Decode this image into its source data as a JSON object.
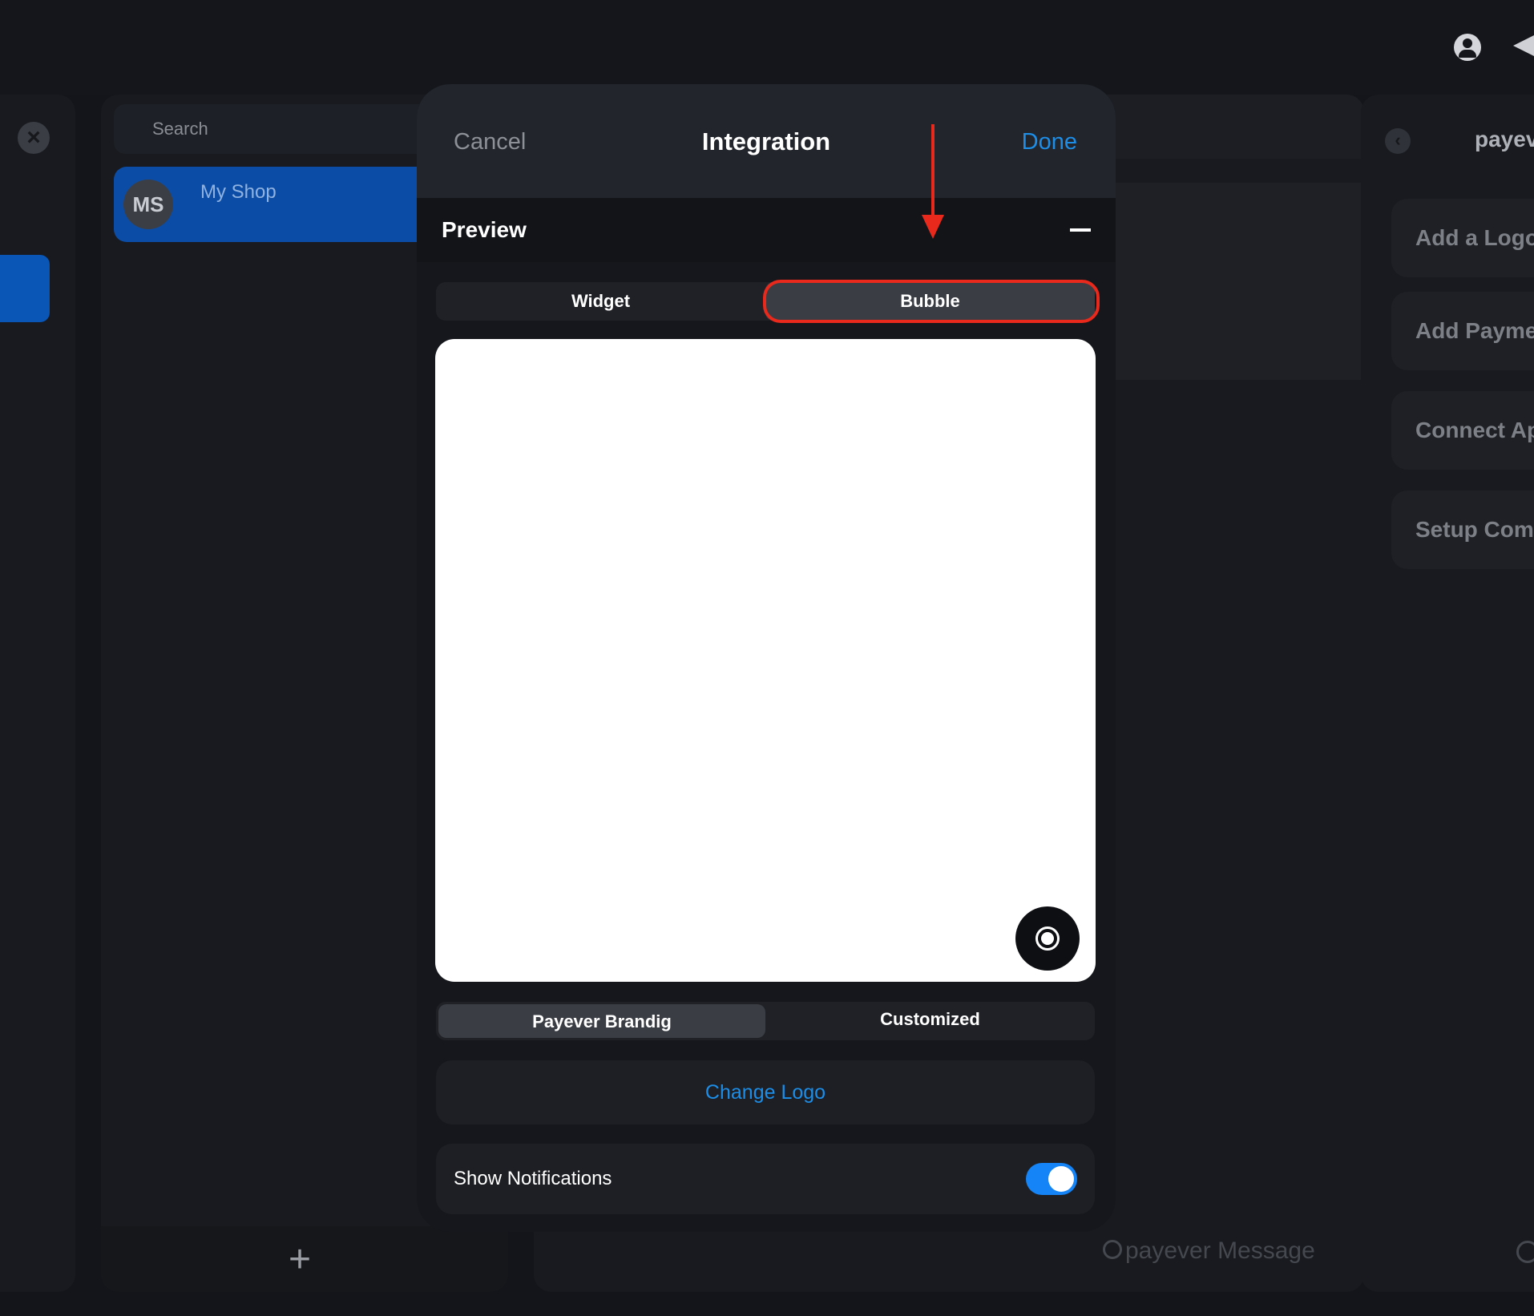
{
  "topbar": {
    "icons": [
      "user-icon",
      "send-icon"
    ]
  },
  "chat_list": {
    "search_placeholder": "Search",
    "items": [
      {
        "initials": "MS",
        "name": "My Shop"
      }
    ],
    "footer_icon": "+"
  },
  "main": {
    "brand_text": "payever Message"
  },
  "right_panel": {
    "title": "payev",
    "cards": [
      "Add a Logo",
      "Add Payme",
      "Connect Ap",
      "Setup Comn"
    ]
  },
  "modal": {
    "cancel_label": "Cancel",
    "title": "Integration",
    "done_label": "Done",
    "section_label": "Preview",
    "collapse_icon": "minus-icon",
    "preview_tabs": [
      "Widget",
      "Bubble"
    ],
    "selected_preview_tab": "Bubble",
    "branding_tabs": [
      "Payever Brandig",
      "Customized"
    ],
    "selected_branding_tab": "Payever Brandig",
    "change_logo_label": "Change Logo",
    "show_notifications_label": "Show Notifications",
    "show_notifications_on": true
  },
  "colors": {
    "accent": "#1d8ee8",
    "toggle_on": "#1484f6",
    "annotation": "#e8291b",
    "selected_item": "#0b4da6"
  }
}
